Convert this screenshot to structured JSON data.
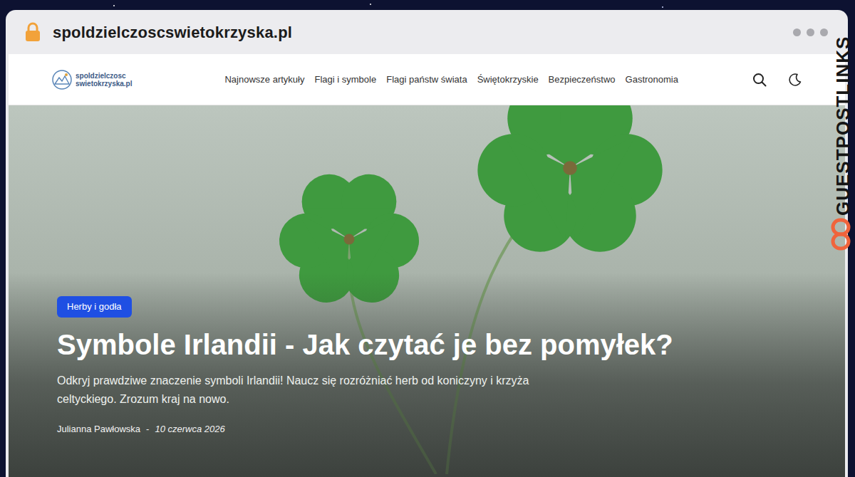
{
  "browser": {
    "url": "spoldzielczoscswietokrzyska.pl"
  },
  "watermark": {
    "text": "GUESTPOSTLINKS"
  },
  "site": {
    "logo_lines": [
      "spoldzielczosc",
      "swietokrzyska.pl"
    ]
  },
  "nav": {
    "items": [
      "Najnowsze artykuły",
      "Flagi i symbole",
      "Flagi państw świata",
      "Świętokrzyskie",
      "Bezpieczeństwo",
      "Gastronomia"
    ]
  },
  "hero": {
    "category": "Herby i godła",
    "title": "Symbole Irlandii - Jak czytać je bez pomyłek?",
    "excerpt": "Odkryj prawdziwe znaczenie symboli Irlandii! Naucz się rozróżniać herb od koniczyny i krzyża celtyckiego. Zrozum kraj na nowo.",
    "author": "Julianna Pawłowska",
    "separator": "-",
    "date": "10 czerwca 2026"
  }
}
